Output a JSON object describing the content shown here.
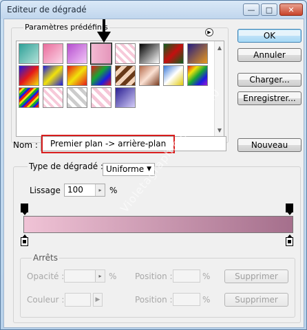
{
  "window": {
    "title": "Editeur de dégradé",
    "minimize_glyph": "—",
    "maximize_glyph": "□",
    "close_glyph": "✕"
  },
  "presets": {
    "label": "Paramètres prédéfinis",
    "selected_index": 3,
    "swatches": [
      {
        "g": "linear-gradient(135deg,#2ea098,#b3e2d8)"
      },
      {
        "g": "linear-gradient(135deg,#ea6c9c,#fbd7e8)"
      },
      {
        "g": "linear-gradient(135deg,#b54dcf,#f3c8f7)"
      },
      {
        "g": "linear-gradient(90deg,#f3b9d2,#e596bb)"
      },
      {
        "g": "repeating-linear-gradient(45deg,#f7c9d9 0 4px,#fff 4px 8px)"
      },
      {
        "g": "linear-gradient(135deg,#000,#fff)"
      },
      {
        "g": "linear-gradient(135deg,#0c5e1e,#c40f0f 50%,#0c5e1e)"
      },
      {
        "g": "linear-gradient(135deg,#231d82,#e9981c)"
      },
      {
        "g": "linear-gradient(135deg,#1b1be0,#e51919 50%,#f1e20b)"
      },
      {
        "g": "linear-gradient(135deg,#1b1be0,#f1e20b 50%,#1b1be0)"
      },
      {
        "g": "linear-gradient(135deg,#e51919,#f1e20b 50%,#e51919)"
      },
      {
        "g": "linear-gradient(135deg,#e51919,#16a535 40%,#1b1be0 70%,#e51919)"
      },
      {
        "g": "repeating-linear-gradient(135deg,#6a3a18 0 6px,#f3d3b9 6px 12px)"
      },
      {
        "g": "linear-gradient(135deg,#b46a4b,#fbe1d3 50%,#7a3c20)"
      },
      {
        "g": "linear-gradient(135deg,#3a79d9,#fff 50%,#e1c80c)"
      },
      {
        "g": "linear-gradient(135deg,#e51919,#f1e20b,#16a535,#1b1be0,#9a1bd6)"
      },
      {
        "g": "repeating-linear-gradient(135deg,#e51919 0 3px,#f1e20b 3px 6px,#16a535 6px 9px,#1b1be0 9px 12px)"
      },
      {
        "g": "repeating-linear-gradient(45deg,#f7c9d9 0 4px,#fff 4px 8px)"
      },
      {
        "g": "repeating-linear-gradient(45deg,#ccc 0 5px,#fff 5px 10px)"
      },
      {
        "g": "repeating-linear-gradient(45deg,#f5c6d7 0 5px,#fff 5px 10px)"
      },
      {
        "g": "linear-gradient(135deg,#2a1f93,#d4cdf8)"
      }
    ]
  },
  "buttons": {
    "ok": "OK",
    "cancel": "Annuler",
    "load": "Charger...",
    "save": "Enregistrer...",
    "new": "Nouveau"
  },
  "name": {
    "label": "Nom :",
    "value": "Premier plan -> arrière-plan"
  },
  "gradient_type": {
    "label": "Type de dégradé :",
    "value": "Uniforme"
  },
  "smoothness": {
    "label": "Lissage :",
    "value": "100",
    "unit": "%"
  },
  "gradient": {
    "start_color": "#f0c3d6",
    "end_color": "#a56f8c"
  },
  "stops": {
    "group_label": "Arrêts",
    "opacity_label": "Opacité :",
    "opacity_unit": "%",
    "opacity_position_label": "Position :",
    "opacity_position_unit": "%",
    "opacity_delete": "Supprimer",
    "color_label": "Couleur :",
    "color_position_label": "Position :",
    "color_position_unit": "%",
    "color_delete": "Supprimer"
  },
  "watermark": "Violetagraphic.com/2010",
  "colors": {
    "highlight_red": "#d81c1c",
    "ok_blue": "#3c7fb1"
  }
}
